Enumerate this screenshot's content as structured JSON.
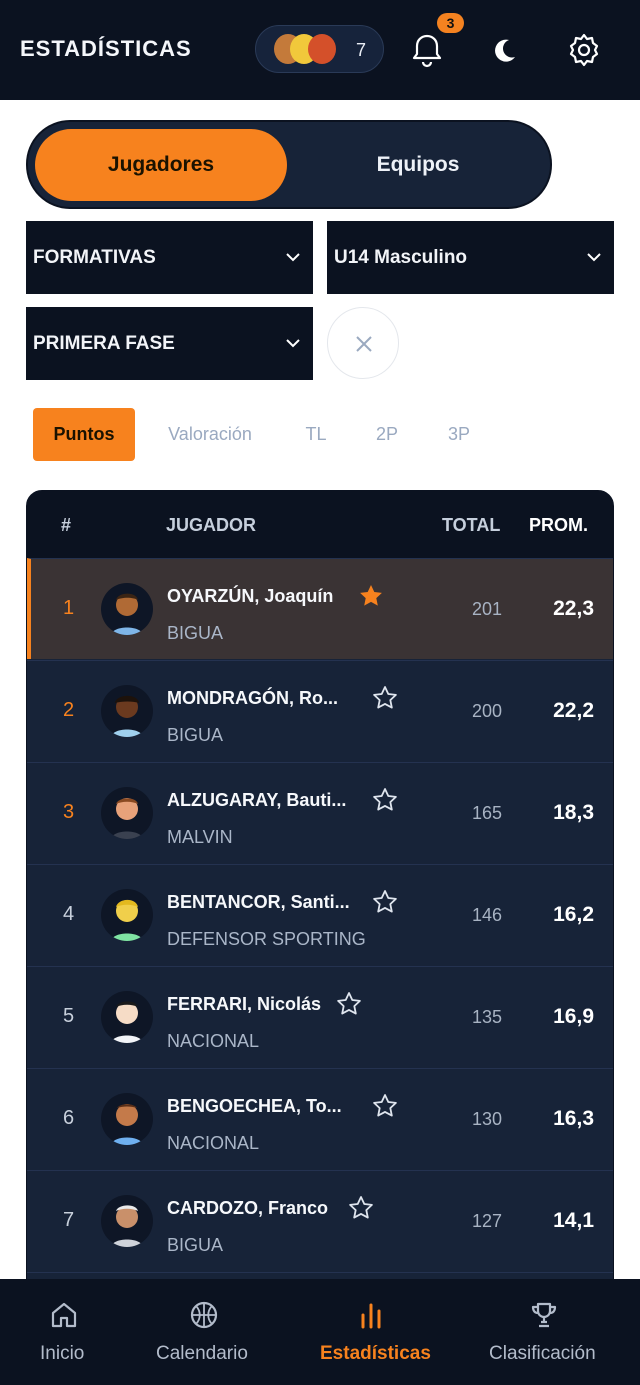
{
  "header": {
    "title": "ESTADÍSTICAS",
    "followers_count": "7",
    "notifications_count": "3"
  },
  "segment": {
    "players_label": "Jugadores",
    "teams_label": "Equipos"
  },
  "filters": {
    "category": "FORMATIVAS",
    "division": "U14 Masculino",
    "phase": "PRIMERA FASE"
  },
  "stat_tabs": [
    "Puntos",
    "Valoración",
    "TL",
    "2P",
    "3P"
  ],
  "table": {
    "headers": {
      "rank": "#",
      "player": "JUGADOR",
      "total": "TOTAL",
      "avg": "PROM."
    },
    "rows": [
      {
        "rank": "1",
        "name": "OYARZÚN, Joaquín",
        "team": "BIGUA",
        "total": "201",
        "avg": "22,3",
        "favorite": true
      },
      {
        "rank": "2",
        "name": "MONDRAGÓN, Ro...",
        "team": "BIGUA",
        "total": "200",
        "avg": "22,2",
        "favorite": false
      },
      {
        "rank": "3",
        "name": "ALZUGARAY, Bauti...",
        "team": "MALVIN",
        "total": "165",
        "avg": "18,3",
        "favorite": false
      },
      {
        "rank": "4",
        "name": "BENTANCOR, Santi...",
        "team": "DEFENSOR SPORTING",
        "total": "146",
        "avg": "16,2",
        "favorite": false
      },
      {
        "rank": "5",
        "name": "FERRARI, Nicolás",
        "team": "NACIONAL",
        "total": "135",
        "avg": "16,9",
        "favorite": false
      },
      {
        "rank": "6",
        "name": "BENGOECHEA, To...",
        "team": "NACIONAL",
        "total": "130",
        "avg": "16,3",
        "favorite": false
      },
      {
        "rank": "7",
        "name": "CARDOZO, Franco",
        "team": "BIGUA",
        "total": "127",
        "avg": "14,1",
        "favorite": false
      }
    ]
  },
  "bottom_nav": {
    "home": "Inicio",
    "calendar": "Calendario",
    "stats": "Estadísticas",
    "standings": "Clasificación"
  },
  "colors": {
    "accent": "#f7821e",
    "dark": "#0b1220",
    "card": "#172338"
  }
}
